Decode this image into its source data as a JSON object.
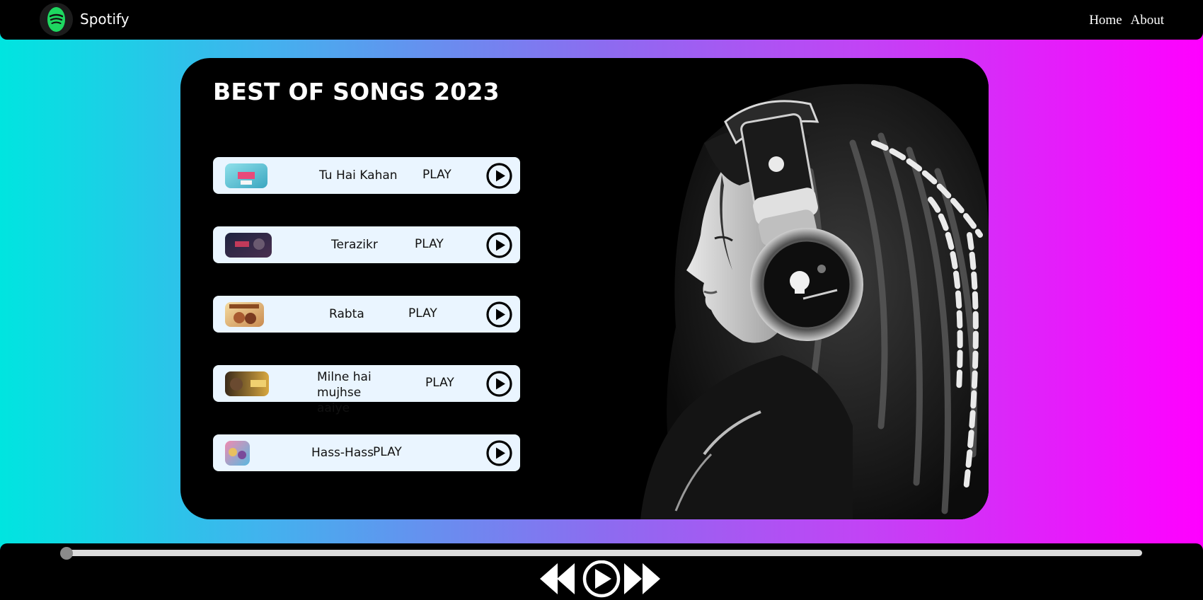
{
  "navbar": {
    "brand": "Spotify",
    "links": [
      "Home",
      "About"
    ]
  },
  "card": {
    "title": "BEST OF SONGS 2023",
    "songs": [
      {
        "name": "Tu Hai Kahan",
        "action": "PLAY",
        "thumb_colors": [
          "#5ec8d8",
          "#e84a7a"
        ]
      },
      {
        "name": "Terazikr",
        "action": "PLAY",
        "thumb_colors": [
          "#2a2f4a",
          "#8a3a6a"
        ]
      },
      {
        "name": "Rabta",
        "action": "PLAY",
        "thumb_colors": [
          "#f0d28a",
          "#c76a3a"
        ]
      },
      {
        "name": "Milne hai mujhse aaiye",
        "action": "PLAY",
        "thumb_colors": [
          "#3a2a1a",
          "#e0b030"
        ]
      },
      {
        "name": "Hass-Hass",
        "action": "PLAY",
        "thumb_colors": [
          "#e879a0",
          "#4fb3d9"
        ]
      }
    ]
  },
  "player": {
    "progress": 0
  },
  "colors": {
    "accent": "#1ed760",
    "gradient_left": "#00e5e0",
    "gradient_right": "#ff00ff",
    "row_bg": "#eaf5ff"
  }
}
